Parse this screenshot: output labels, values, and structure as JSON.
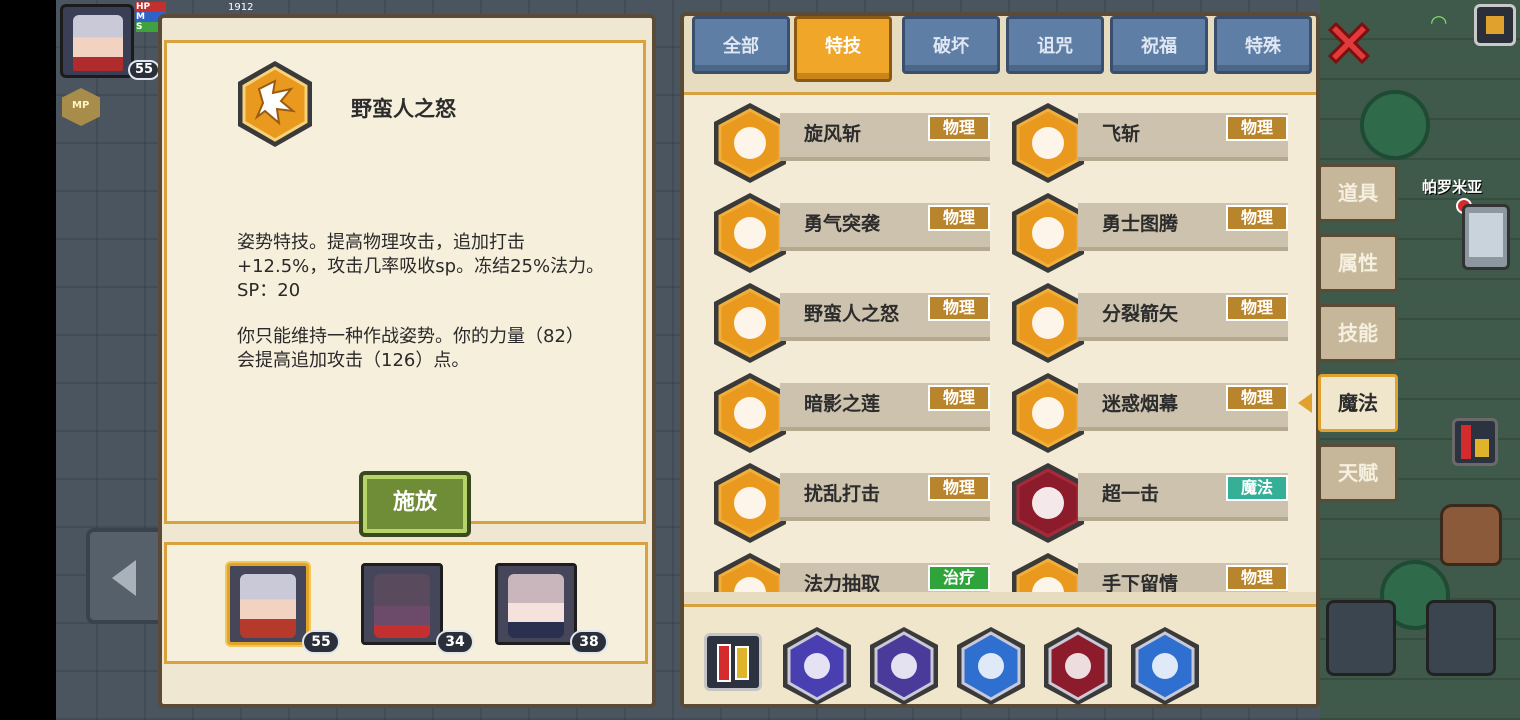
{
  "hud": {
    "hp_label": "HP",
    "mp_label": "M",
    "sp_label": "S",
    "hp_value": "1912",
    "level": "55",
    "mp_coin": "MP"
  },
  "detail": {
    "title": "野蛮人之怒",
    "desc_line1": "姿势特技。提高物理攻击，追加打击",
    "desc_line2": "+12.5%，攻击几率吸收sp。冻结25%法力。",
    "desc_line3": "SP：20",
    "desc_line4": "你只能维持一种作战姿势。你的力量（82）",
    "desc_line5": "会提高追加攻击（126）点。",
    "cast_label": "施放"
  },
  "party": [
    {
      "level": "55",
      "color": "#b53a2c"
    },
    {
      "level": "34",
      "color": "#6b4a6a"
    },
    {
      "level": "38",
      "color": "#c9b6bd"
    }
  ],
  "tabs": [
    "全部",
    "特技",
    "破坏",
    "诅咒",
    "祝福",
    "特殊"
  ],
  "active_tab": "特技",
  "skills": [
    {
      "name": "旋风斩",
      "tag": "物理",
      "tag_type": "physical",
      "icon": "pinwheel-icon"
    },
    {
      "name": "飞斩",
      "tag": "物理",
      "tag_type": "physical",
      "icon": "flying-blade-icon"
    },
    {
      "name": "勇气突袭",
      "tag": "物理",
      "tag_type": "physical",
      "icon": "crescent-slash-icon"
    },
    {
      "name": "勇士图腾",
      "tag": "物理",
      "tag_type": "physical",
      "icon": "totem-icon"
    },
    {
      "name": "野蛮人之怒",
      "tag": "物理",
      "tag_type": "physical",
      "icon": "barbarian-rage-icon"
    },
    {
      "name": "分裂箭矢",
      "tag": "物理",
      "tag_type": "physical",
      "icon": "split-arrow-icon"
    },
    {
      "name": "暗影之莲",
      "tag": "物理",
      "tag_type": "physical",
      "icon": "flame-lotus-icon"
    },
    {
      "name": "迷惑烟幕",
      "tag": "物理",
      "tag_type": "physical",
      "icon": "smoke-cloud-icon"
    },
    {
      "name": "扰乱打击",
      "tag": "物理",
      "tag_type": "physical",
      "icon": "dagger-strike-icon"
    },
    {
      "name": "超一击",
      "tag": "魔法",
      "tag_type": "magic",
      "icon": "super-strike-icon"
    },
    {
      "name": "法力抽取",
      "tag": "治疗",
      "tag_type": "heal",
      "icon": "mana-drain-icon"
    },
    {
      "name": "手下留情",
      "tag": "物理",
      "tag_type": "physical",
      "icon": "open-hand-icon"
    }
  ],
  "schools": [
    {
      "icon": "arcane-flame-icon",
      "color": "#4a3fb0"
    },
    {
      "icon": "eye-icon",
      "color": "#4a3a9a"
    },
    {
      "icon": "water-drop-icon",
      "color": "#2f6fd0"
    },
    {
      "icon": "vortex-icon",
      "color": "#8c1c2c"
    },
    {
      "icon": "ice-spear-icon",
      "color": "#2f6fd0"
    }
  ],
  "side_menu": [
    "道具",
    "属性",
    "技能",
    "魔法",
    "天赋"
  ],
  "active_side": "魔法",
  "map_label": "帕罗米亚",
  "colors": {
    "accent_orange": "#f0a628",
    "tab_blue": "#5f7ea6",
    "physical_tag": "#b9852c",
    "magic_tag": "#35b097",
    "heal_tag": "#2fa43a"
  }
}
